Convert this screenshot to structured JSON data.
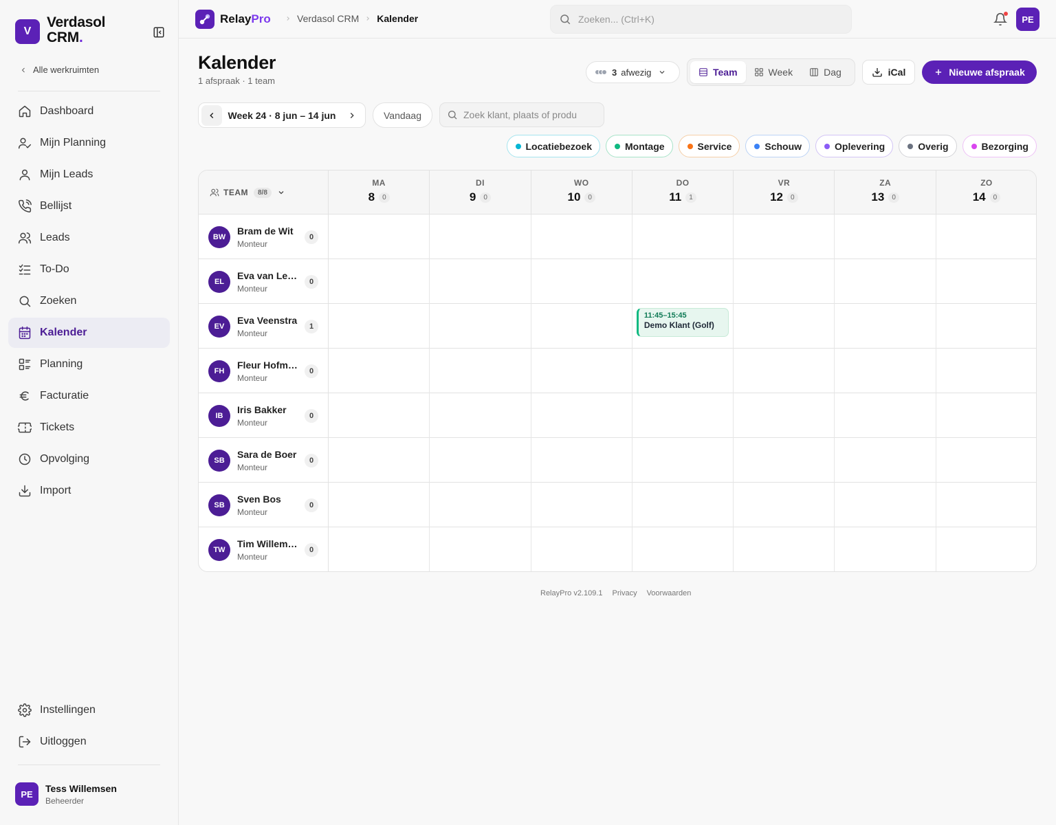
{
  "sidebar": {
    "badge": "V",
    "brand_line1": "Verdasol",
    "brand_line2": "CRM",
    "brand_dot": ".",
    "back_label": "Alle werkruimten",
    "items": [
      {
        "label": "Dashboard",
        "icon": "home-icon"
      },
      {
        "label": "Mijn Planning",
        "icon": "user-check-icon"
      },
      {
        "label": "Mijn Leads",
        "icon": "user-icon"
      },
      {
        "label": "Bellijst",
        "icon": "phone-icon"
      },
      {
        "label": "Leads",
        "icon": "users-icon"
      },
      {
        "label": "To-Do",
        "icon": "list-check-icon"
      },
      {
        "label": "Zoeken",
        "icon": "search-icon"
      },
      {
        "label": "Kalender",
        "icon": "calendar-icon",
        "active": true
      },
      {
        "label": "Planning",
        "icon": "planning-icon"
      },
      {
        "label": "Facturatie",
        "icon": "euro-icon"
      },
      {
        "label": "Tickets",
        "icon": "ticket-icon"
      },
      {
        "label": "Opvolging",
        "icon": "clock-icon"
      },
      {
        "label": "Import",
        "icon": "download-icon"
      }
    ],
    "bottom_items": [
      {
        "label": "Instellingen",
        "icon": "gear-icon"
      },
      {
        "label": "Uitloggen",
        "icon": "logout-icon"
      }
    ],
    "user": {
      "initials": "PE",
      "name": "Tess Willemsen",
      "role": "Beheerder"
    }
  },
  "topbar": {
    "logo_main": "Relay",
    "logo_accent": "Pro",
    "breadcrumb": [
      "Verdasol CRM",
      "Kalender"
    ],
    "search_placeholder": "Zoeken... (Ctrl+K)",
    "avatar": "PE"
  },
  "header": {
    "title": "Kalender",
    "subtitle": "1 afspraak · 1 team",
    "absent_count": "3",
    "absent_label": "afwezig",
    "views": [
      {
        "label": "Team",
        "icon": "list-icon",
        "active": true
      },
      {
        "label": "Week",
        "icon": "grid-icon"
      },
      {
        "label": "Dag",
        "icon": "columns-icon"
      }
    ],
    "ical_label": "iCal",
    "new_label": "Nieuwe afspraak"
  },
  "toolbar": {
    "week_label": "Week 24 · 8 jun – 14 jun",
    "today_label": "Vandaag",
    "search_placeholder": "Zoek klant, plaats of produ"
  },
  "legend": [
    {
      "label": "Locatiebezoek",
      "color": "#06b6d4",
      "border": "#a5e4ee"
    },
    {
      "label": "Montage",
      "color": "#10b981",
      "border": "#a7e3c8"
    },
    {
      "label": "Service",
      "color": "#f97316",
      "border": "#f5cfa8"
    },
    {
      "label": "Schouw",
      "color": "#3b82f6",
      "border": "#bcd3f5"
    },
    {
      "label": "Oplevering",
      "color": "#8b5cf6",
      "border": "#d2c4f5"
    },
    {
      "label": "Overig",
      "color": "#6b7280",
      "border": "#d4d4d8"
    },
    {
      "label": "Bezorging",
      "color": "#d946ef",
      "border": "#eec2f6"
    }
  ],
  "grid": {
    "team_label": "TEAM",
    "team_count": "8/8",
    "days": [
      {
        "name": "MA",
        "date": "8",
        "count": "0"
      },
      {
        "name": "DI",
        "date": "9",
        "count": "0"
      },
      {
        "name": "WO",
        "date": "10",
        "count": "0"
      },
      {
        "name": "DO",
        "date": "11",
        "count": "1"
      },
      {
        "name": "VR",
        "date": "12",
        "count": "0"
      },
      {
        "name": "ZA",
        "date": "13",
        "count": "0"
      },
      {
        "name": "ZO",
        "date": "14",
        "count": "0"
      }
    ],
    "members": [
      {
        "initials": "BW",
        "name": "Bram de Wit",
        "role": "Monteur",
        "count": "0"
      },
      {
        "initials": "EL",
        "name": "Eva van Leeuwen",
        "role": "Monteur",
        "count": "0"
      },
      {
        "initials": "EV",
        "name": "Eva Veenstra",
        "role": "Monteur",
        "count": "1"
      },
      {
        "initials": "FH",
        "name": "Fleur Hofman",
        "role": "Monteur",
        "count": "0"
      },
      {
        "initials": "IB",
        "name": "Iris Bakker",
        "role": "Monteur",
        "count": "0"
      },
      {
        "initials": "SB",
        "name": "Sara de Boer",
        "role": "Monteur",
        "count": "0"
      },
      {
        "initials": "SB",
        "name": "Sven Bos",
        "role": "Monteur",
        "count": "0"
      },
      {
        "initials": "TW",
        "name": "Tim Willemsen",
        "role": "Monteur",
        "count": "0"
      }
    ],
    "events": [
      {
        "member": 2,
        "day": 3,
        "time": "11:45–15:45",
        "title": "Demo Klant (Golf)",
        "type": "Montage"
      }
    ]
  },
  "footer": {
    "app": "RelayPro",
    "version": "v2.109.1",
    "privacy": "Privacy",
    "terms": "Voorwaarden"
  }
}
